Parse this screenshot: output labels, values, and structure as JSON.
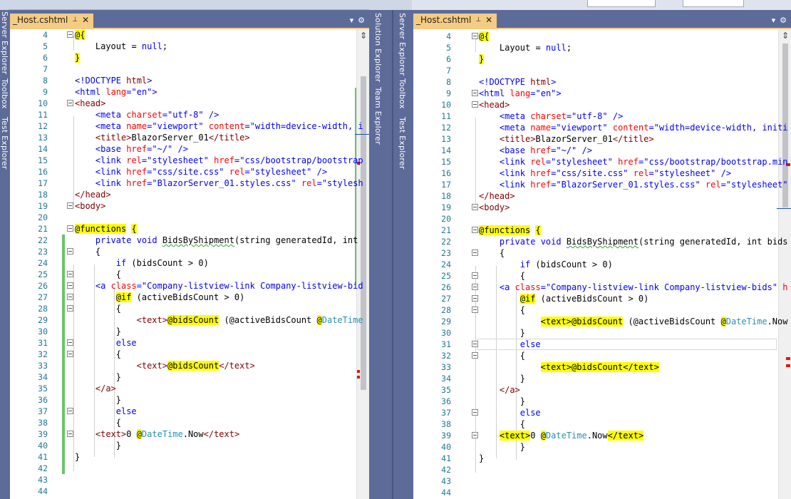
{
  "left_tab": {
    "name": "_Host.cshtml",
    "pin": "⊥",
    "close": "✕"
  },
  "right_tab": {
    "name": "_Host.cshtml",
    "pin": "⊥",
    "close": "✕"
  },
  "pane_menu": {
    "dropdown": "▾",
    "settings": "⚙"
  },
  "left_side_labels": [
    "Server Explorer",
    "Toolbox",
    "Test Explorer"
  ],
  "middle_side_labels": [
    "Solution Explorer",
    "Team Explorer"
  ],
  "right_side_labels": [
    "Server Explorer",
    "Toolbox",
    "Test Explorer"
  ],
  "line_numbers": [
    "4",
    "5",
    "6",
    "7",
    "8",
    "9",
    "10",
    "11",
    "12",
    "13",
    "14",
    "15",
    "16",
    "17",
    "18",
    "19",
    "20",
    "21",
    "22",
    "23",
    "24",
    "25",
    "26",
    "27",
    "28",
    "29",
    "30",
    "31",
    "32",
    "33",
    "34",
    "35",
    "36",
    "37",
    "38",
    "39",
    "40",
    "41",
    "42",
    "43",
    "44"
  ],
  "code_tokens": {
    "at_brace": "@{",
    "layout": "Layout",
    "eq": " = ",
    "null": "null",
    "semi": ";",
    "close_brace": "}",
    "doctype_open": "<!DOCTYPE ",
    "html_word": "html",
    "gt": ">",
    "html_open": "<html",
    "lang_attr": "lang",
    "lang_val": "\"en\"",
    "head_open": "<head>",
    "head_close": "</head>",
    "body_open": "<body>",
    "meta_open": "<meta",
    "charset_attr": "charset",
    "charset_val": "\"utf-8\"",
    "self_close": " />",
    "name_attr": "name",
    "name_val": "\"viewport\"",
    "content_attr": "content",
    "content_val_left": "\"width=device-width, i",
    "content_val_right": "\"width=device-width, initi",
    "title_open": "<title>",
    "title_text": "BlazorServer_01",
    "title_close": "</title>",
    "base_open": "<base",
    "href_attr": "href",
    "href_root": "\"~/\"",
    "link_open": "<link",
    "rel_attr": "rel",
    "rel_val": "\"stylesheet\"",
    "bootstrap_left": "\"css/bootstrap/bootstrap",
    "bootstrap_right": "\"css/bootstrap/bootstrap.min",
    "site_css": "\"css/site.css\"",
    "styles_css": "\"BlazorServer_01.styles.css\"",
    "stylesh_cut": "\"stylesh",
    "functions": "@functions",
    "open_brace": "{",
    "private": "private",
    "void": "void",
    "method": "BidsByShipment",
    "params_left": "(string generatedId, int",
    "params_right": "(string generatedId, int bids",
    "if_kw": "if",
    "if_cond": " (bidsCount > 0)",
    "a_open": "<a",
    "class_attr": "class",
    "class_val_left": "\"Company-listview-link Company-listview-bid",
    "class_val_right": "\"Company-listview-link Company-listview-bids\"",
    "h_cut": "h",
    "at_if": "@if",
    "if_cond2": " (activeBidsCount > 0)",
    "text_open": "<text>",
    "text_close": "</text>",
    "at_bidsCount": "@bidsCount",
    "paren_active": " (@activeBidsCount ",
    "at_datetime_at": "@",
    "datetime": "DateTime",
    "dot_now": ".Now",
    "else_kw": "else",
    "a_close": "</a>",
    "zero_sp": "0 "
  }
}
